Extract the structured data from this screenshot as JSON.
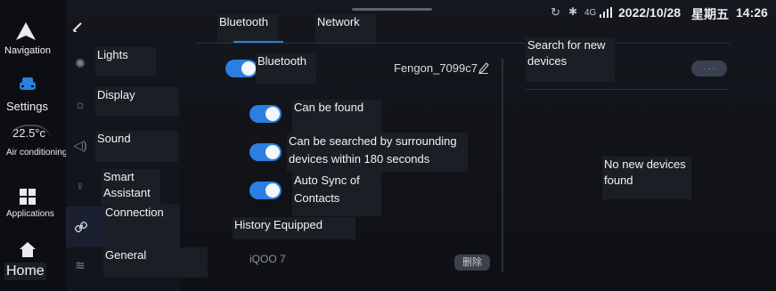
{
  "status_bar": {
    "network": "4G",
    "datetime": "2022/10/28",
    "weekday": "星期五",
    "time": "14:26"
  },
  "rail": {
    "navigation": "Navigation",
    "settings": "Settings",
    "temperature": "22.5°c",
    "air_conditioning": "Air conditioning",
    "applications": "Applications",
    "home": "Home"
  },
  "menu": {
    "items": [
      {
        "label": "Lights",
        "icon": "lightbulb-icon"
      },
      {
        "label": "Display",
        "icon": "brightness-icon"
      },
      {
        "label": "Sound",
        "icon": "speaker-icon"
      },
      {
        "label": "Smart Assistant",
        "icon": "microphone-icon"
      },
      {
        "label": "Connection",
        "icon": "link-icon"
      },
      {
        "label": "General",
        "icon": "layers-icon"
      }
    ]
  },
  "tabs": {
    "bluetooth": "Bluetooth",
    "network": "Network"
  },
  "bluetooth": {
    "title": "Bluetooth",
    "device_name": "Fengon_7099c7",
    "can_be_found": "Can be found",
    "searchable_line1": "Can be searched by surrounding",
    "searchable_line2": "devices within 180 seconds",
    "auto_sync_line1": "Auto Sync of",
    "auto_sync_line2": "Contacts",
    "history_title": "History Equipped",
    "history_device": "iQOO 7",
    "delete_label": "删除"
  },
  "search": {
    "title_line1": "Search for new",
    "title_line2": "devices",
    "empty_line1": "No new devices",
    "empty_line2": "found"
  },
  "colors": {
    "accent": "#2a7fe0",
    "background": "#111319"
  }
}
